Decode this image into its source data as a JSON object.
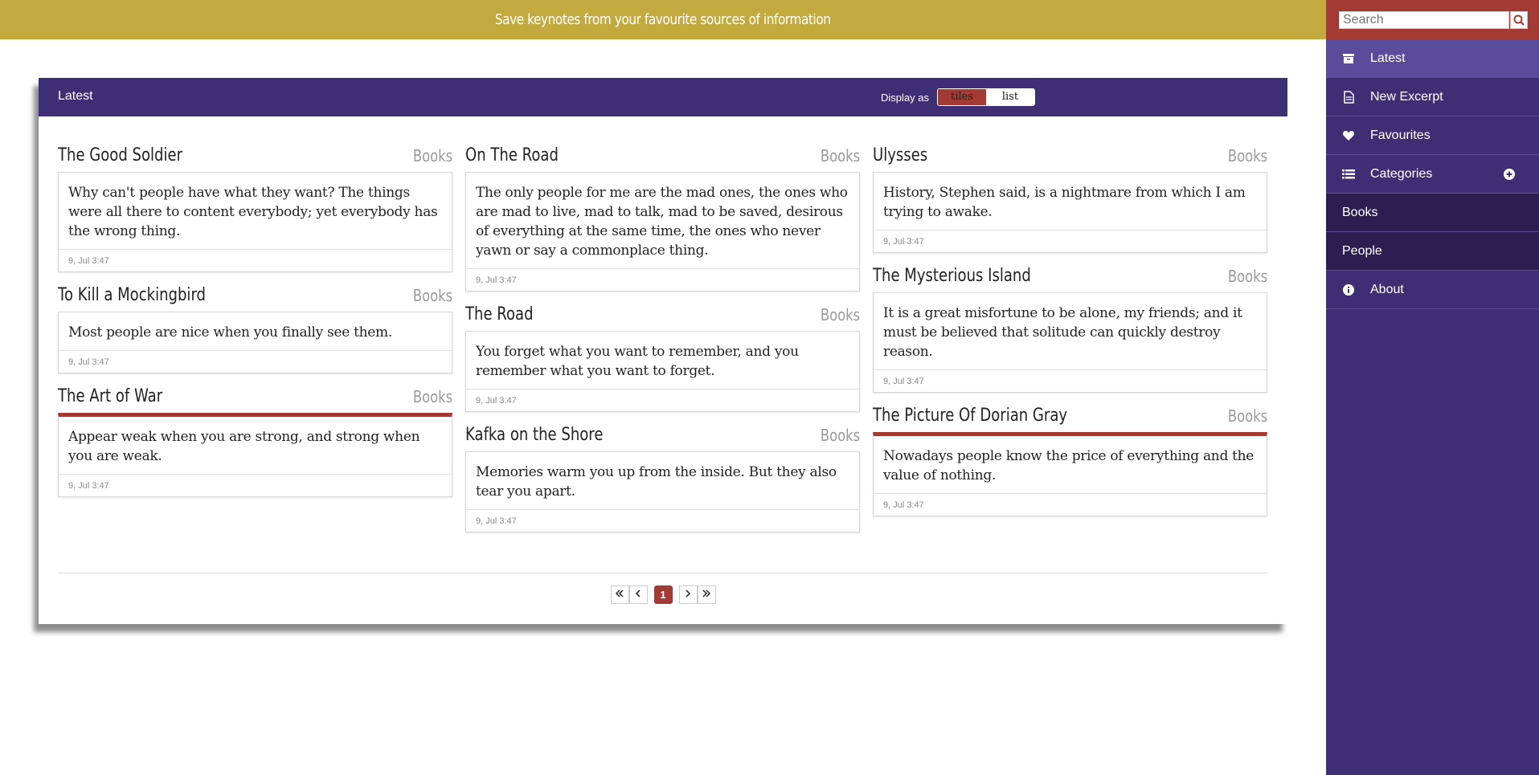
{
  "banner": {
    "text": "Save keynotes from your favourite sources of information"
  },
  "panel": {
    "title": "Latest",
    "display_as_label": "Display as",
    "display_options": [
      "tiles",
      "list"
    ]
  },
  "columns": [
    [
      {
        "title": "The Good Soldier",
        "category": "Books",
        "quote": "Why can't people have what they want? The things were all there to content everybody; yet everybody has the wrong thing.",
        "date": "9, Jul  3:47",
        "favourite": false
      },
      {
        "title": "To Kill a Mockingbird",
        "category": "Books",
        "quote": "Most people are nice when you finally see them.",
        "date": "9, Jul  3:47",
        "favourite": false
      },
      {
        "title": "The Art of War",
        "category": "Books",
        "quote": "Appear weak when you are strong, and strong when you are weak.",
        "date": "9, Jul  3:47",
        "favourite": true
      }
    ],
    [
      {
        "title": "On The Road",
        "category": "Books",
        "quote": "The only people for me are the mad ones, the ones who are mad to live, mad to talk, mad to be saved, desirous of everything at the same time, the ones who never yawn or say a commonplace thing.",
        "date": "9, Jul  3:47",
        "favourite": false
      },
      {
        "title": "The Road",
        "category": "Books",
        "quote": "You forget what you want to remember, and you remember what you want to forget.",
        "date": "9, Jul  3:47",
        "favourite": false
      },
      {
        "title": "Kafka on the Shore",
        "category": "Books",
        "quote": "Memories warm you up from the inside. But they also tear you apart.",
        "date": "9, Jul  3:47",
        "favourite": false
      }
    ],
    [
      {
        "title": "Ulysses",
        "category": "Books",
        "quote": "History, Stephen said, is a nightmare from which I am trying to awake.",
        "date": "9, Jul  3:47",
        "favourite": false
      },
      {
        "title": "The Mysterious Island",
        "category": "Books",
        "quote": "It is a great misfortune to be alone, my friends; and it must be believed that solitude can quickly destroy reason.",
        "date": "9, Jul  3:47",
        "favourite": false
      },
      {
        "title": "The Picture Of Dorian Gray",
        "category": "Books",
        "quote": "Nowadays people know the price of everything and the value of nothing.",
        "date": "9, Jul  3:47",
        "favourite": true
      }
    ]
  ],
  "pagination": {
    "current_page": "1"
  },
  "sidebar": {
    "search_placeholder": "Search",
    "items": [
      {
        "label": "Latest",
        "icon": "archive-icon"
      },
      {
        "label": "New Excerpt",
        "icon": "file-icon"
      },
      {
        "label": "Favourites",
        "icon": "heart-icon"
      },
      {
        "label": "Categories",
        "icon": "list-icon"
      }
    ],
    "categories": [
      "Books",
      "People"
    ],
    "about": {
      "label": "About",
      "icon": "info-icon"
    }
  },
  "colors": {
    "banner": "#c2aa3f",
    "primary": "#3e2f74",
    "accent": "#a33a33"
  }
}
